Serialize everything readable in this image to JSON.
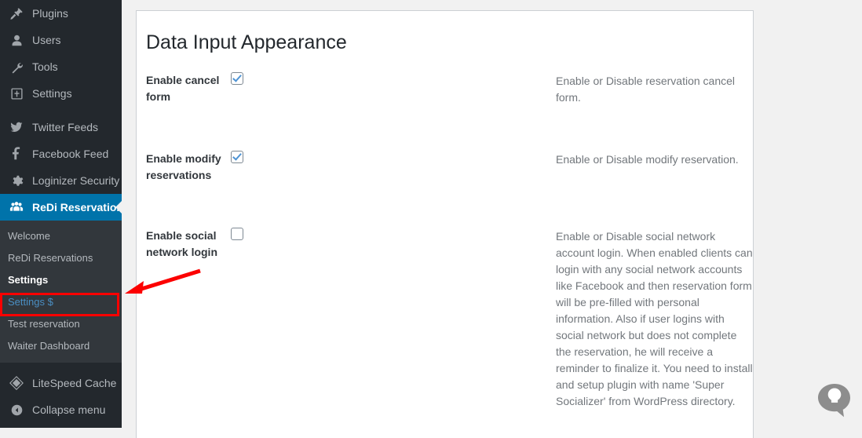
{
  "sidebar": {
    "items": [
      {
        "label": "Plugins",
        "icon": "plugin-icon"
      },
      {
        "label": "Users",
        "icon": "user-icon"
      },
      {
        "label": "Tools",
        "icon": "wrench-icon"
      },
      {
        "label": "Settings",
        "icon": "settings-icon"
      },
      {
        "label": "Twitter Feeds",
        "icon": "twitter-icon"
      },
      {
        "label": "Facebook Feed",
        "icon": "facebook-icon"
      },
      {
        "label": "Loginizer Security",
        "icon": "gear-icon"
      },
      {
        "label": "ReDi Reservations",
        "icon": "group-icon"
      }
    ],
    "submenu": [
      {
        "label": "Welcome"
      },
      {
        "label": "ReDi Reservations"
      },
      {
        "label": "Settings"
      },
      {
        "label": "Settings $"
      },
      {
        "label": "Test reservation"
      },
      {
        "label": "Waiter Dashboard"
      }
    ],
    "bottom": [
      {
        "label": "LiteSpeed Cache",
        "icon": "litespeed-icon"
      },
      {
        "label": "Collapse menu",
        "icon": "collapse-icon"
      }
    ],
    "active_item": "ReDi Reservations",
    "current_submenu": "Settings",
    "highlighted_submenu": "Settings $",
    "accent_color": "#0073aa",
    "background_color": "#23282d",
    "submenu_background_color": "#32373c"
  },
  "annotation": {
    "highlight_color": "#fc0000",
    "highlight_target": "Settings $"
  },
  "main": {
    "title": "Data Input Appearance",
    "settings": [
      {
        "label": "Enable cancel form",
        "checked": true,
        "description": "Enable or Disable reservation cancel form."
      },
      {
        "label": "Enable modify reservations",
        "checked": true,
        "description": "Enable or Disable modify reservation."
      },
      {
        "label": "Enable social network login",
        "checked": false,
        "description": "Enable or Disable social network account login. When enabled clients can login with any social network accounts like Facebook and then reservation form will be pre-filled with personal information. Also if user logins with social network but does not complete the reservation, he will receive a reminder to finalize it. You need to install and setup plugin with name 'Super Socializer' from WordPress directory."
      }
    ]
  },
  "help": {
    "icon": "lightbulb-help-icon"
  }
}
